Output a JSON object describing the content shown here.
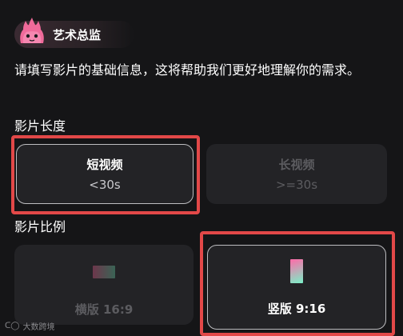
{
  "header": {
    "title": "艺术总监",
    "mascot_icon": "pink-flame-mascot-icon"
  },
  "intro_text": "请填写影片的基础信息，这将帮助我们更好地理解你的需求。",
  "duration_section": {
    "label": "影片长度",
    "options": [
      {
        "title": "短视频",
        "subtitle": "<30s",
        "selected": true
      },
      {
        "title": "长视频",
        "subtitle": ">=30s",
        "selected": false
      }
    ]
  },
  "ratio_section": {
    "label": "影片比例",
    "options": [
      {
        "label": "横版 16:9",
        "icon": "landscape-ratio-icon",
        "selected": false
      },
      {
        "label": "竖版 9:16",
        "icon": "portrait-ratio-icon",
        "selected": true
      }
    ]
  },
  "watermark": {
    "text": "大数跨境",
    "logo": "watermark-logo-icon"
  },
  "colors": {
    "highlight": "#e24848",
    "background": "#151517",
    "card": "#232326"
  }
}
